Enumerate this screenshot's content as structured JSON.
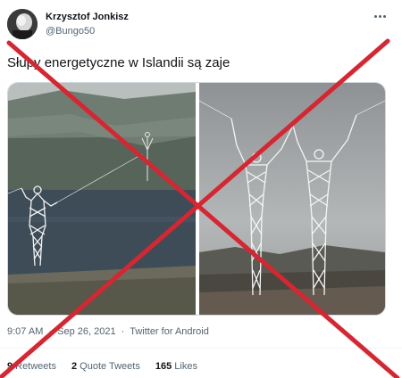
{
  "author": {
    "name": "Krzysztof Jonkisz",
    "handle": "@Bungo50"
  },
  "tweet": {
    "text": "Słupy energetyczne w Islandii są zaje"
  },
  "meta": {
    "time": "9:07 AM",
    "separator": "·",
    "date": "Sep 26, 2021",
    "source": "Twitter for Android"
  },
  "stats": {
    "retweets_count": "9",
    "retweets_label": "Retweets",
    "quotes_count": "2",
    "quotes_label": "Quote Tweets",
    "likes_count": "165",
    "likes_label": "Likes"
  },
  "icons": {
    "more": "more-dots-icon"
  },
  "colors": {
    "text_primary": "#0f1419",
    "text_secondary": "#536471",
    "border": "#cfd9de",
    "cross": "#d62631"
  }
}
